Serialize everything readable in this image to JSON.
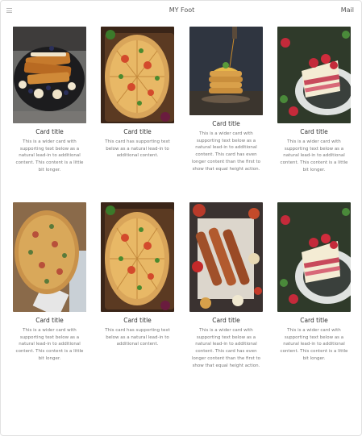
{
  "header": {
    "title": "MY Foot",
    "mail_label": "Mail"
  },
  "cards": [
    {
      "title": "Card title",
      "text": "This is a wider card with supporting text below as a natural lead-in to additional content. This content is a little bit longer.",
      "image": "french-toast-photo"
    },
    {
      "title": "Card title",
      "text": "This card has supporting text below as a natural lead-in to additional content.",
      "image": "pizza-photo"
    },
    {
      "title": "Card title",
      "text": "This is a wider card with supporting text below as a natural lead-in to additional content. This card has even longer content than the first to show that equal height action.",
      "image": "pancakes-photo"
    },
    {
      "title": "Card title",
      "text": "This is a wider card with supporting text below as a natural lead-in to additional content. This content is a little bit longer.",
      "image": "strawberry-cake-photo"
    },
    {
      "title": "Card title",
      "text": "This is a wider card with supporting text below as a natural lead-in to additional content. This content is a little bit longer.",
      "image": "pizza-board-photo"
    },
    {
      "title": "Card title",
      "text": "This card has supporting text below as a natural lead-in to additional content.",
      "image": "pizza-photo"
    },
    {
      "title": "Card title",
      "text": "This is a wider card with supporting text below as a natural lead-in to additional content. This card has even longer content than the first to show that equal height action.",
      "image": "kebab-platter-photo"
    },
    {
      "title": "Card title",
      "text": "This is a wider card with supporting text below as a natural lead-in to additional content. This content is a little bit longer.",
      "image": "strawberry-cake-photo"
    }
  ]
}
